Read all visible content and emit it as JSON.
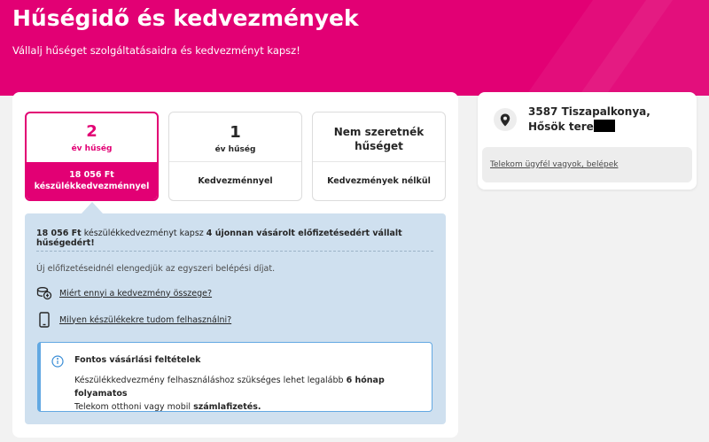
{
  "hero": {
    "title": "Hűségidő és kedvezmények",
    "subtitle": "Vállalj hűséget szolgáltatásaidra és kedvezményt kapsz!"
  },
  "options": [
    {
      "number": "2",
      "unit": "év hűség",
      "benefit": "18 056 Ft készülékkedvezménnyel",
      "selected": true
    },
    {
      "number": "1",
      "unit": "év hűség",
      "benefit": "Kedvezménnyel",
      "selected": false
    },
    {
      "title": "Nem szeretnék hűséget",
      "benefit": "Kedvezmények nélkül",
      "selected": false
    }
  ],
  "info": {
    "line1_amount": "18 056 Ft",
    "line1_mid": " készülékkedvezményt kapsz ",
    "line1_bold": "4 újonnan vásárolt előfizetésedért vállalt hűségedért!",
    "line2": "Új előfizetéseidnél elengedjük az egyszeri belépési díjat.",
    "link1": "Miért ennyi a kedvezmény összege?",
    "link2": "Milyen készülékekre tudom felhasználni?",
    "notice": {
      "heading": "Fontos vásárlási feltételek",
      "p_part1": "Készülékkedvezmény felhasználáshoz szükséges lehet legalább ",
      "p_bold1": "6 hónap folyamatos",
      "p_part2": "Telekom otthoni vagy mobil ",
      "p_bold2": "számlafizetés."
    }
  },
  "side": {
    "address_line": "3587 Tiszapalkonya, Hősök tere",
    "login_link": "Telekom ügyfél vagyok, belépek"
  },
  "colors": {
    "brand": "#e20074",
    "info_bg": "#cfe0ef",
    "notice_accent": "#62a8e2"
  },
  "icons": [
    "location-pin-icon",
    "coins-icon",
    "phone-icon",
    "info-icon"
  ]
}
